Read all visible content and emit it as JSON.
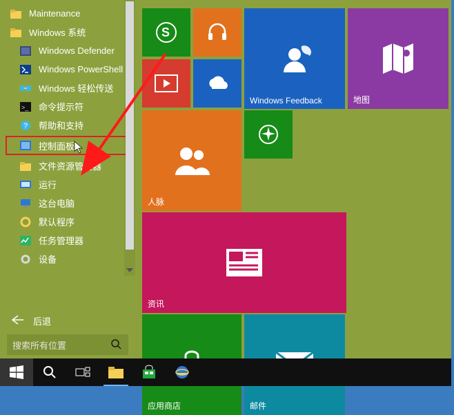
{
  "left": {
    "folders": [
      {
        "label": "Maintenance"
      },
      {
        "label": "Windows 系统"
      }
    ],
    "items": [
      {
        "label": "Windows Defender"
      },
      {
        "label": "Windows PowerShell"
      },
      {
        "label": "Windows 轻松传送"
      },
      {
        "label": "命令提示符"
      },
      {
        "label": "帮助和支持"
      },
      {
        "label": "控制面板"
      },
      {
        "label": "文件资源管理器"
      },
      {
        "label": "运行"
      },
      {
        "label": "这台电脑"
      },
      {
        "label": "默认程序"
      },
      {
        "label": "任务管理器"
      },
      {
        "label": "设备"
      }
    ],
    "back": "后退",
    "search_placeholder": "搜索所有位置"
  },
  "tiles": {
    "skype": "",
    "headphones": "",
    "feedback": "Windows Feedback",
    "map": "地图",
    "video": "",
    "onedrive": "",
    "people": "人脉",
    "help": "",
    "news": "资讯",
    "store": "应用商店",
    "mail": "邮件"
  },
  "colors": {
    "menu_bg": "#8ca13e",
    "highlight_border": "#d22"
  }
}
